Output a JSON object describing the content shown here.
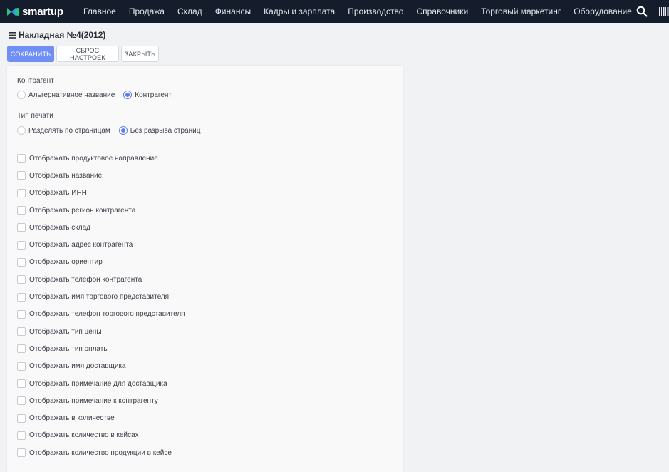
{
  "app": {
    "logo_text": "smartup",
    "nav": [
      {
        "label": "Главное"
      },
      {
        "label": "Продажа"
      },
      {
        "label": "Склад"
      },
      {
        "label": "Финансы"
      },
      {
        "label": "Кадры и зарплата"
      },
      {
        "label": "Производство"
      },
      {
        "label": "Справочники"
      },
      {
        "label": "Торговый маркетинг"
      },
      {
        "label": "Оборудование"
      }
    ],
    "colors": {
      "navbar": "#151c2b",
      "accent": "#6f8ff5",
      "logo_green": "#22c48a",
      "logo_blue": "#3f8cf0"
    },
    "icons": {
      "search": "search-icon",
      "barcode": "barcode-icon"
    }
  },
  "page": {
    "title": "Накладная №4(2012)",
    "toolbar": {
      "save_label": "СОХРАНИТЬ",
      "reset_label": "СБРОС НАСТРОЕК",
      "close_label": "ЗАКРЫТЬ"
    }
  },
  "form": {
    "counterparty": {
      "label": "Контрагент",
      "options": [
        {
          "label": "Альтернативное название",
          "checked": false
        },
        {
          "label": "Контрагент",
          "checked": true
        }
      ]
    },
    "print_type": {
      "label": "Тип печати",
      "options": [
        {
          "label": "Разделять по страницам",
          "checked": false
        },
        {
          "label": "Без разрыва страниц",
          "checked": true
        }
      ]
    },
    "checkboxes": [
      {
        "label": "Отображать продуктовое направление",
        "checked": false
      },
      {
        "label": "Отображать название",
        "checked": false
      },
      {
        "label": "Отображать ИНН",
        "checked": false
      },
      {
        "label": "Отображать регион контрагента",
        "checked": false
      },
      {
        "label": "Отображать склад",
        "checked": false
      },
      {
        "label": "Отображать адрес контрагента",
        "checked": false
      },
      {
        "label": "Отображать ориентир",
        "checked": false
      },
      {
        "label": "Отображать телефон контрагента",
        "checked": false
      },
      {
        "label": "Отображать имя торгового представителя",
        "checked": false
      },
      {
        "label": "Отображать телефон торгового представителя",
        "checked": false
      },
      {
        "label": "Отображать тип цены",
        "checked": false
      },
      {
        "label": "Отображать тип оплаты",
        "checked": false
      },
      {
        "label": "Отображать имя доставщика",
        "checked": false
      },
      {
        "label": "Отображать примечание для доставщика",
        "checked": false
      },
      {
        "label": "Отображать примечание к контрагенту",
        "checked": false
      },
      {
        "label": "Отображать в количестве",
        "checked": false
      },
      {
        "label": "Отображать количество в кейсах",
        "checked": false
      },
      {
        "label": "Отображать количество продукции в кейсе",
        "checked": false
      }
    ]
  }
}
